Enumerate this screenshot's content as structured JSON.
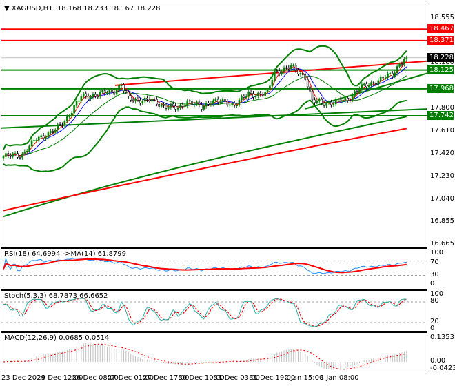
{
  "header": {
    "symbol": "XAGUSD,H1",
    "ohlc": "18.168 18.233 18.167 18.228"
  },
  "price_axis": [
    "18.555",
    "18.180",
    "17.800",
    "17.610",
    "17.420",
    "17.230",
    "17.040",
    "16.855",
    "16.665"
  ],
  "level_tags": [
    {
      "label": "18.467",
      "price": 18.467,
      "color": "#ff0000"
    },
    {
      "label": "18.371",
      "price": 18.371,
      "color": "#ff0000"
    },
    {
      "label": "18.228",
      "price": 18.228,
      "color": "#000000"
    },
    {
      "label": "18.125",
      "price": 18.125,
      "color": "#008000"
    },
    {
      "label": "17.968",
      "price": 17.968,
      "color": "#008000"
    },
    {
      "label": "17.742",
      "price": 17.742,
      "color": "#008000"
    }
  ],
  "price_series": {
    "bars": 172,
    "keypoints": [
      [
        0,
        17.4
      ],
      [
        8,
        17.42
      ],
      [
        14,
        17.55
      ],
      [
        22,
        17.62
      ],
      [
        26,
        17.7
      ],
      [
        33,
        17.9
      ],
      [
        40,
        17.92
      ],
      [
        47,
        17.95
      ],
      [
        50,
        18.0
      ],
      [
        53,
        17.88
      ],
      [
        62,
        17.87
      ],
      [
        68,
        17.83
      ],
      [
        74,
        17.8
      ],
      [
        78,
        17.87
      ],
      [
        84,
        17.81
      ],
      [
        88,
        17.87
      ],
      [
        98,
        17.84
      ],
      [
        104,
        17.92
      ],
      [
        112,
        17.93
      ],
      [
        115,
        18.11
      ],
      [
        122,
        18.15
      ],
      [
        128,
        18.07
      ],
      [
        131,
        17.86
      ],
      [
        140,
        17.85
      ],
      [
        146,
        17.88
      ],
      [
        151,
        17.97
      ],
      [
        158,
        18.03
      ],
      [
        165,
        18.09
      ],
      [
        168,
        18.18
      ],
      [
        171,
        18.228
      ]
    ]
  },
  "rsi": {
    "title": "RSI(18) 64.6994  ->MA(14) 61.8799",
    "scale": [
      "100",
      "70",
      "30",
      "0"
    ]
  },
  "stoch": {
    "title": "Stoch(5,3,3) 68.7873 66.6652",
    "scale": [
      "100",
      "80",
      "20",
      "0"
    ]
  },
  "macd": {
    "title": "MACD(12,26,9) 0.0685 0.0514",
    "scale": [
      "0.1353",
      "0.00",
      "-0.0423"
    ]
  },
  "time_axis": [
    "23 Dec 2019",
    "24 Dec 12:00",
    "26 Dec 08:00",
    "27 Dec 01:00",
    "27 Dec 17:00",
    "30 Dec 10:00",
    "31 Dec 03:00",
    "31 Dec 19:00",
    "2 Jan 15:00",
    "3 Jan 08:00"
  ],
  "colors": {
    "bull": "#008000",
    "bear": "#000000",
    "red": "#ff0000",
    "green": "#008000",
    "rsi": "#1e90ff",
    "stoch": "#20b2aa",
    "macd_hist": "#c0c0c0"
  }
}
